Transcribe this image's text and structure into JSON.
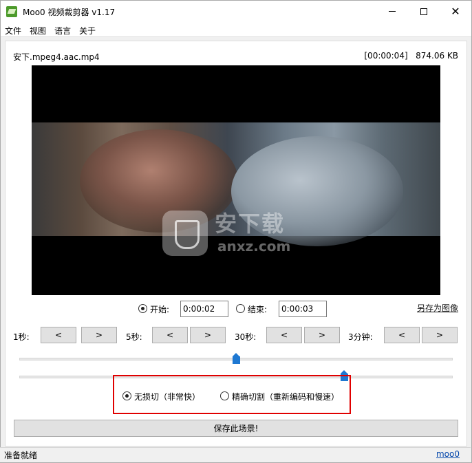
{
  "window": {
    "title": "Moo0 视频裁剪器 v1.17",
    "minimize_glyph": "",
    "close_glyph": "✕"
  },
  "menu": {
    "items": [
      "文件",
      "视图",
      "语言",
      "关于"
    ]
  },
  "file": {
    "name": "安下.mpeg4.aac.mp4",
    "duration": "[00:00:04]",
    "size": "874.06 KB"
  },
  "watermark": {
    "big": "安下载",
    "small": "anxz.com"
  },
  "range": {
    "start_label": "开始:",
    "start_value": "0:00:02",
    "start_checked": true,
    "end_label": "结束:",
    "end_value": "0:00:03",
    "end_checked": false,
    "save_image_label": "另存为图像"
  },
  "steps": [
    {
      "label": "1秒:",
      "back": "<",
      "fwd": ">"
    },
    {
      "label": "5秒:",
      "back": "<",
      "fwd": ">"
    },
    {
      "label": "30秒:",
      "back": "<",
      "fwd": ">"
    },
    {
      "label": "3分钟:",
      "back": "<",
      "fwd": ">"
    }
  ],
  "sliders": {
    "start_fraction": 0.5,
    "end_fraction": 0.75
  },
  "modes": {
    "lossless_label": "无损切（非常快）",
    "lossless_checked": true,
    "precise_label": "精确切割（重新编码和慢速）",
    "precise_checked": false
  },
  "save_scene_label": "保存此场景!",
  "status": {
    "text": "准备就绪",
    "link": "moo0"
  },
  "colors": {
    "accent": "#1e78d2",
    "highlight_box": "#e00000"
  }
}
